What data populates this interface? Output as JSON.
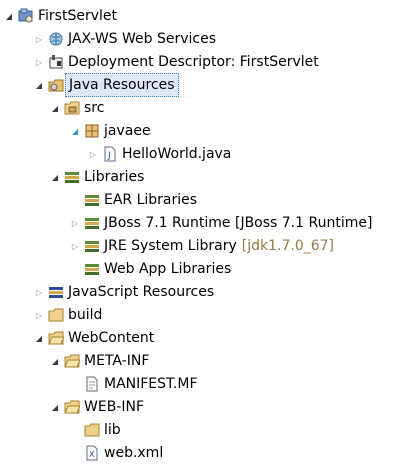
{
  "tree": {
    "items": [
      {
        "label": "FirstServlet",
        "icon": "project-icon",
        "arrow": "open"
      },
      {
        "label": "JAX-WS Web Services",
        "icon": "webservices-icon",
        "arrow": "closed"
      },
      {
        "label": "Deployment Descriptor: FirstServlet",
        "icon": "deployment-descriptor-icon",
        "arrow": "closed"
      },
      {
        "label": "Java Resources",
        "icon": "java-resources-icon",
        "arrow": "open",
        "selected": true
      },
      {
        "label": "src",
        "icon": "source-folder-icon",
        "arrow": "open"
      },
      {
        "label": "javaee",
        "icon": "package-icon",
        "arrow": "open"
      },
      {
        "label": "HelloWorld.java",
        "icon": "java-file-icon",
        "arrow": "closed"
      },
      {
        "label": "Libraries",
        "icon": "libraries-icon",
        "arrow": "open"
      },
      {
        "label": "EAR Libraries",
        "icon": "library-icon",
        "arrow": "none"
      },
      {
        "label": "JBoss 7.1 Runtime [JBoss 7.1 Runtime]",
        "icon": "library-icon",
        "arrow": "closed"
      },
      {
        "label": "JRE System Library",
        "decoration": "[jdk1.7.0_67]",
        "icon": "library-icon",
        "arrow": "closed"
      },
      {
        "label": "Web App Libraries",
        "icon": "library-icon",
        "arrow": "none"
      },
      {
        "label": "JavaScript Resources",
        "icon": "javascript-resources-icon",
        "arrow": "closed"
      },
      {
        "label": "build",
        "icon": "folder-icon",
        "arrow": "closed"
      },
      {
        "label": "WebContent",
        "icon": "folder-open-icon",
        "arrow": "open"
      },
      {
        "label": "META-INF",
        "icon": "folder-open-icon",
        "arrow": "open"
      },
      {
        "label": "MANIFEST.MF",
        "icon": "manifest-file-icon",
        "arrow": "none"
      },
      {
        "label": "WEB-INF",
        "icon": "folder-open-icon",
        "arrow": "open"
      },
      {
        "label": "lib",
        "icon": "folder-icon",
        "arrow": "none"
      },
      {
        "label": "web.xml",
        "icon": "xml-file-icon",
        "arrow": "none"
      }
    ]
  }
}
